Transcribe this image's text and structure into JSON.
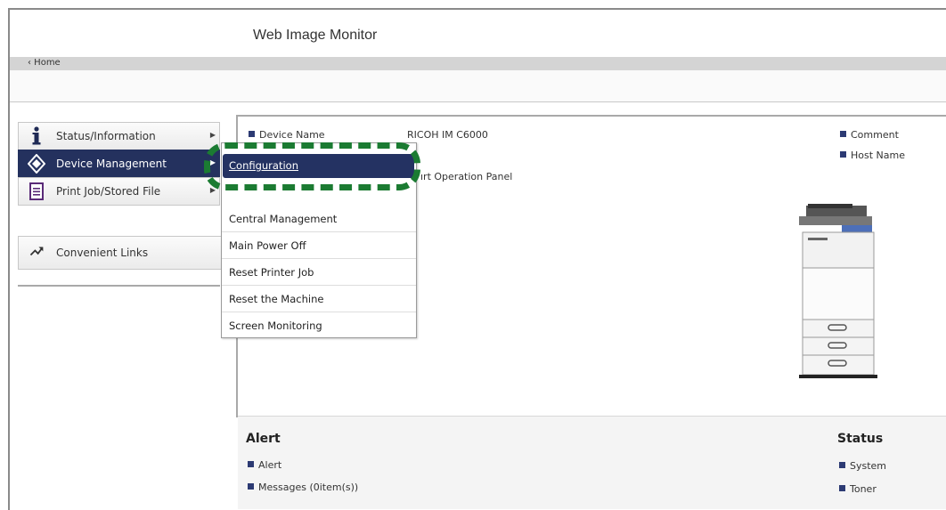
{
  "header": {
    "title": "Web Image Monitor",
    "home_link": "‹ Home"
  },
  "sidebar": {
    "items": [
      {
        "label": "Status/Information",
        "icon": "info-icon",
        "has_submenu": true
      },
      {
        "label": "Device Management",
        "icon": "device-management-icon",
        "has_submenu": true,
        "selected": true
      },
      {
        "label": "Print Job/Stored File",
        "icon": "document-icon",
        "has_submenu": true
      }
    ],
    "links": {
      "label": "Convenient Links",
      "icon": "arrow-link-icon"
    }
  },
  "device_info": {
    "device_name_label": "Device Name",
    "device_name_value": "RICOH IM C6000",
    "operation_panel_text": "ırt Operation Panel",
    "comment_label": "Comment",
    "host_name_label": "Host Name"
  },
  "dropdown": {
    "items": [
      {
        "label": "Configuration",
        "highlighted": true
      },
      {
        "label": "Central Management"
      },
      {
        "label": "Main Power Off"
      },
      {
        "label": "Reset Printer Job"
      },
      {
        "label": "Reset the Machine"
      },
      {
        "label": "Screen Monitoring"
      }
    ]
  },
  "alert": {
    "heading": "Alert",
    "items": [
      "Alert",
      "Messages (0item(s))"
    ]
  },
  "status": {
    "heading": "Status",
    "items": [
      "System",
      "Toner"
    ]
  },
  "colors": {
    "menu_selected": "#24315e",
    "highlight_dash": "#1b7b32",
    "bullet": "#2c3a73"
  }
}
